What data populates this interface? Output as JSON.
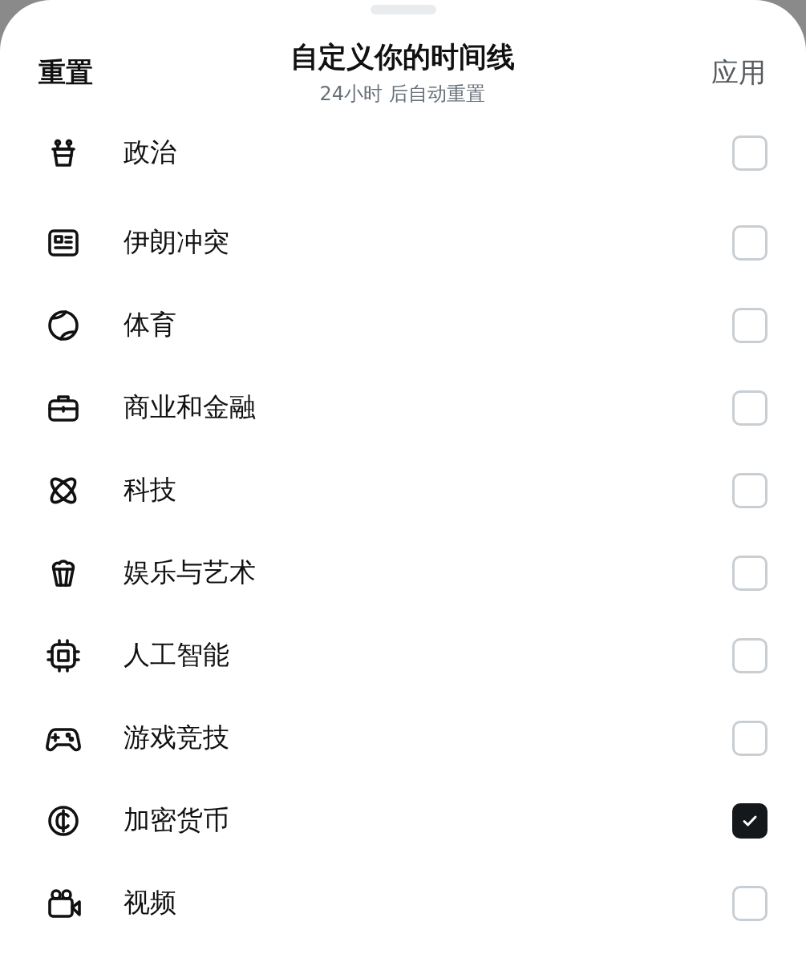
{
  "header": {
    "reset_label": "重置",
    "title": "自定义你的时间线",
    "subtitle": "24小时 后自动重置",
    "apply_label": "应用"
  },
  "topics": [
    {
      "kind": "podium",
      "label": "政治",
      "checked": false
    },
    {
      "kind": "newspaper",
      "label": "伊朗冲突",
      "checked": false
    },
    {
      "kind": "ball",
      "label": "体育",
      "checked": false
    },
    {
      "kind": "briefcase",
      "label": "商业和金融",
      "checked": false
    },
    {
      "kind": "orbit",
      "label": "科技",
      "checked": false
    },
    {
      "kind": "popcorn",
      "label": "娱乐与艺术",
      "checked": false
    },
    {
      "kind": "chip",
      "label": "人工智能",
      "checked": false
    },
    {
      "kind": "gamepad",
      "label": "游戏竞技",
      "checked": false
    },
    {
      "kind": "coin",
      "label": "加密货币",
      "checked": true
    },
    {
      "kind": "camera",
      "label": "视频",
      "checked": false
    }
  ]
}
